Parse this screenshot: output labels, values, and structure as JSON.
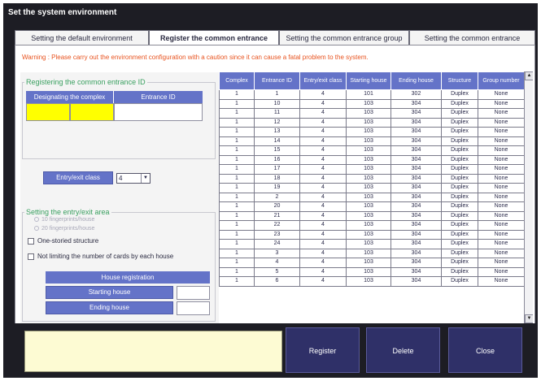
{
  "window": {
    "title": "Set the system environment"
  },
  "tabs": [
    {
      "label": "Setting the default environment"
    },
    {
      "label": "Register the common entrance"
    },
    {
      "label": "Setting the common entrance group"
    },
    {
      "label": "Setting the common entrance"
    }
  ],
  "warning": "Warning : Please carry out the environment configuration with a caution since it can cause a fatal problem to the system.",
  "register_id": {
    "legend": "Registering the common entrance ID",
    "designating_complex_label": "Designating the complex",
    "entrance_id_label": "Entrance ID",
    "complex_value": "",
    "entrance_id_value": ""
  },
  "entry_exit": {
    "button_label": "Entry/exit class",
    "selected": "4"
  },
  "area": {
    "legend": "Setting the entry/exit area",
    "radio_10": "10 fingerprints/house",
    "radio_20": "20 fingerprints/house",
    "one_storied": "One-storied structure",
    "not_limiting": "Not limiting the number of cards by each house",
    "house_registration_label": "House registration",
    "starting_house_label": "Starting house",
    "ending_house_label": "Ending house",
    "starting_house_value": "",
    "ending_house_value": ""
  },
  "table": {
    "columns": [
      "Complex",
      "Entrance ID",
      "Entry/exit class",
      "Starting house",
      "Ending house",
      "Structure",
      "Group number"
    ],
    "rows": [
      [
        "1",
        "1",
        "4",
        "101",
        "302",
        "Duplex",
        "None"
      ],
      [
        "1",
        "10",
        "4",
        "103",
        "304",
        "Duplex",
        "None"
      ],
      [
        "1",
        "11",
        "4",
        "103",
        "304",
        "Duplex",
        "None"
      ],
      [
        "1",
        "12",
        "4",
        "103",
        "304",
        "Duplex",
        "None"
      ],
      [
        "1",
        "13",
        "4",
        "103",
        "304",
        "Duplex",
        "None"
      ],
      [
        "1",
        "14",
        "4",
        "103",
        "304",
        "Duplex",
        "None"
      ],
      [
        "1",
        "15",
        "4",
        "103",
        "304",
        "Duplex",
        "None"
      ],
      [
        "1",
        "16",
        "4",
        "103",
        "304",
        "Duplex",
        "None"
      ],
      [
        "1",
        "17",
        "4",
        "103",
        "304",
        "Duplex",
        "None"
      ],
      [
        "1",
        "18",
        "4",
        "103",
        "304",
        "Duplex",
        "None"
      ],
      [
        "1",
        "19",
        "4",
        "103",
        "304",
        "Duplex",
        "None"
      ],
      [
        "1",
        "2",
        "4",
        "103",
        "304",
        "Duplex",
        "None"
      ],
      [
        "1",
        "20",
        "4",
        "103",
        "304",
        "Duplex",
        "None"
      ],
      [
        "1",
        "21",
        "4",
        "103",
        "304",
        "Duplex",
        "None"
      ],
      [
        "1",
        "22",
        "4",
        "103",
        "304",
        "Duplex",
        "None"
      ],
      [
        "1",
        "23",
        "4",
        "103",
        "304",
        "Duplex",
        "None"
      ],
      [
        "1",
        "24",
        "4",
        "103",
        "304",
        "Duplex",
        "None"
      ],
      [
        "1",
        "3",
        "4",
        "103",
        "304",
        "Duplex",
        "None"
      ],
      [
        "1",
        "4",
        "4",
        "103",
        "304",
        "Duplex",
        "None"
      ],
      [
        "1",
        "5",
        "4",
        "103",
        "304",
        "Duplex",
        "None"
      ],
      [
        "1",
        "6",
        "4",
        "103",
        "304",
        "Duplex",
        "None"
      ]
    ]
  },
  "actions": {
    "register": "Register",
    "delete": "Delete",
    "close": "Close"
  },
  "icons": {
    "dropdown": "chevron-down-icon",
    "scroll_up": "arrow-up-icon",
    "scroll_down": "arrow-down-icon"
  },
  "colors": {
    "header_blue": "#6473c8",
    "warning_orange": "#e8531f",
    "legend_green": "#3aa060",
    "highlight_yellow": "#ffff00",
    "action_navy": "#2f3068",
    "message_bg": "#fdfbd3"
  }
}
